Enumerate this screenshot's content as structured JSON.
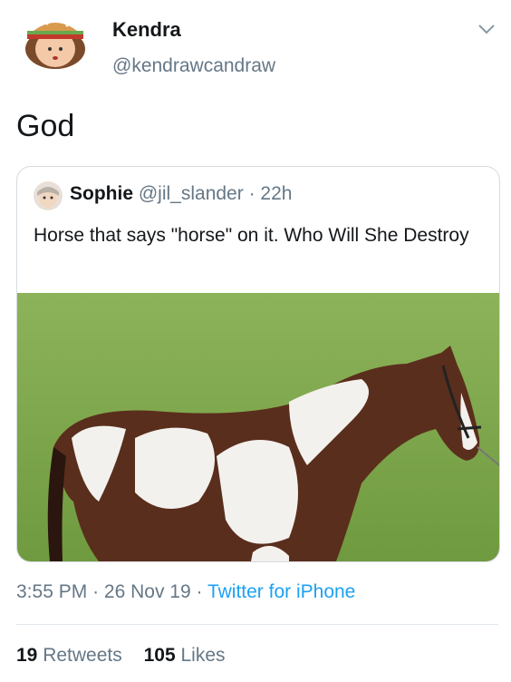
{
  "author": {
    "name": "Kendra",
    "handle": "@kendrawcandraw",
    "avatar_icon": "burger-face-avatar-icon"
  },
  "tweet": {
    "text": "God"
  },
  "quoted_tweet": {
    "name": "Sophie",
    "handle": "@jil_slander",
    "separator": "·",
    "time": "22h",
    "text": "Horse that says \"horse\" on it. Who Will She Destroy",
    "media": "paint-horse-photo"
  },
  "meta": {
    "time": "3:55 PM",
    "date": "26 Nov 19",
    "separator": "·",
    "source": "Twitter for iPhone"
  },
  "stats": {
    "retweets_count": "19",
    "retweets_label": "Retweets",
    "likes_count": "105",
    "likes_label": "Likes"
  },
  "colors": {
    "text": "#14171a",
    "secondary": "#657786",
    "link": "#1da1f2",
    "border": "#d5dbe0"
  }
}
